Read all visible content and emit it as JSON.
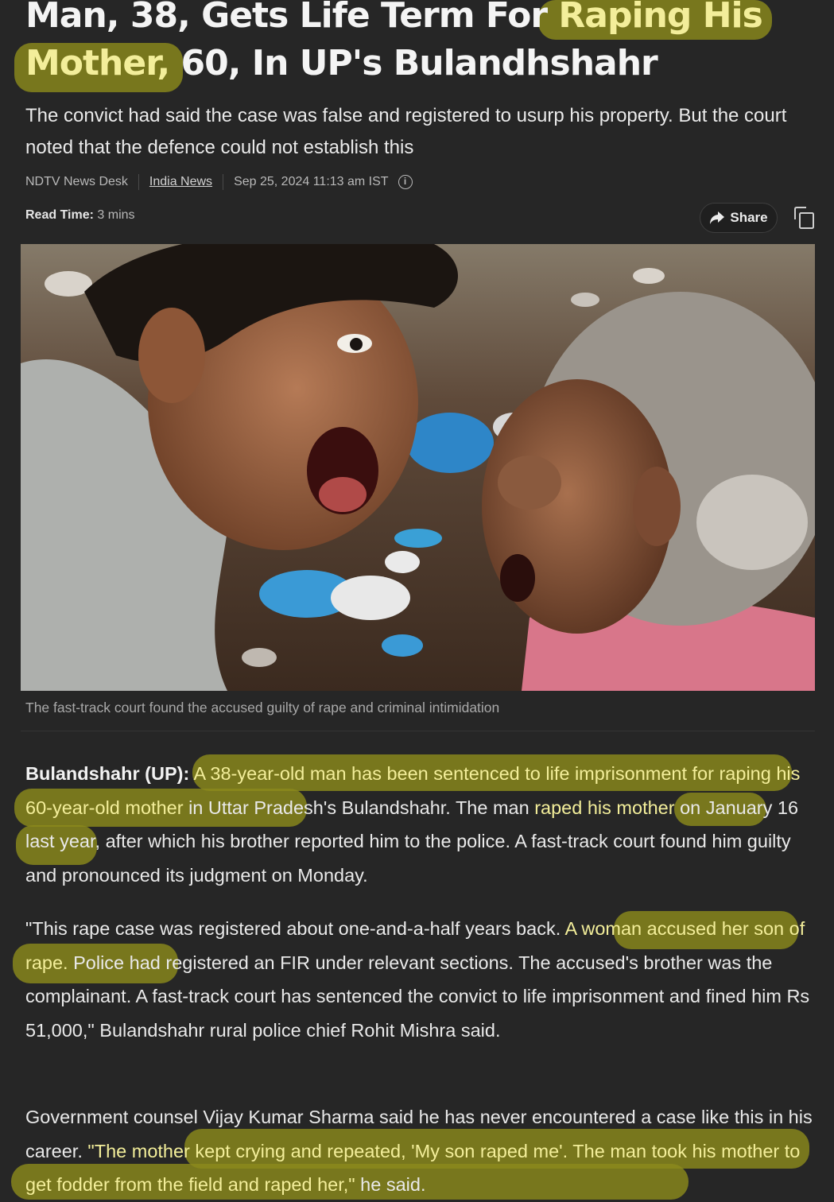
{
  "article": {
    "headline_part1": "Man, 38, Gets Life Term For ",
    "headline_hl1": "Raping His",
    "headline_hl2": "Mother,",
    "headline_part2": " 60, In UP's Bulandhshahr",
    "dek": "The convict had said the case was false and registered to usurp his property. But the court noted that the defence could not establish this",
    "author": "NDTV News Desk",
    "category": "India News",
    "timestamp": "Sep 25, 2024 11:13 am IST",
    "read_time_label": "Read Time:",
    "read_time_value": "3 mins",
    "share_label": "Share",
    "caption": "The fast-track court found the accused guilty of rape and criminal intimidation",
    "p1_lead": "Bulandshahr (UP):",
    "p1_hl1": " A 38-year-old man has been sentenced to life imprisonment for raping his 60-year-old mother",
    "p1_text1": " in Uttar Pradesh's Bulandshahr. The man ",
    "p1_hl2": "raped his mother",
    "p1_text2": " on January 16 last year, after which his brother reported him to the police. A fast-track court found him guilty and pronounced its judgment on Monday.",
    "p2_text1": "\"This rape case was registered about one-and-a-half years back. ",
    "p2_hl1": "A woman accused her son of rape.",
    "p2_text2": " Police had registered an FIR under relevant sections. The accused's brother was the complainant. A fast-track court has sentenced the convict to life imprisonment and fined him Rs 51,000,\" Bulandshahr rural police chief Rohit Mishra said.",
    "p3_text1": "Government counsel Vijay Kumar Sharma said he has never encountered a case like this in his career. ",
    "p3_hl1": "\"The mother kept crying and repeated, 'My son raped me'. The man took his mother to get fodder from the field and raped her,\"",
    "p3_text2": " he said."
  },
  "icons": {
    "info": "info-icon",
    "share": "share-arrow-icon",
    "copy": "copy-icon"
  },
  "colors": {
    "background": "#262626",
    "highlight": "#8b8a1c",
    "text": "#e9e9e9"
  }
}
